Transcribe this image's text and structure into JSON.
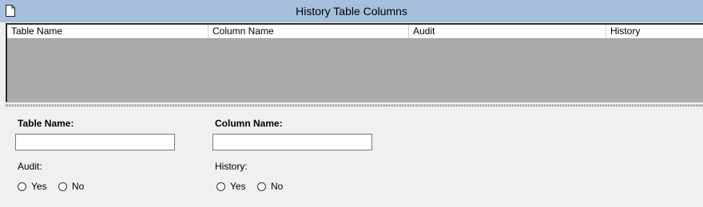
{
  "window": {
    "title": "History Table Columns",
    "icon": "document-icon"
  },
  "grid": {
    "columns": [
      "Table Name",
      "Column Name",
      "Audit",
      "History"
    ],
    "rows": []
  },
  "form": {
    "table_name": {
      "label": "Table Name:",
      "value": ""
    },
    "column_name": {
      "label": "Column Name:",
      "value": ""
    },
    "audit": {
      "label": "Audit:",
      "options": [
        "Yes",
        "No"
      ],
      "selected": null
    },
    "history": {
      "label": "History:",
      "options": [
        "Yes",
        "No"
      ],
      "selected": null
    }
  }
}
